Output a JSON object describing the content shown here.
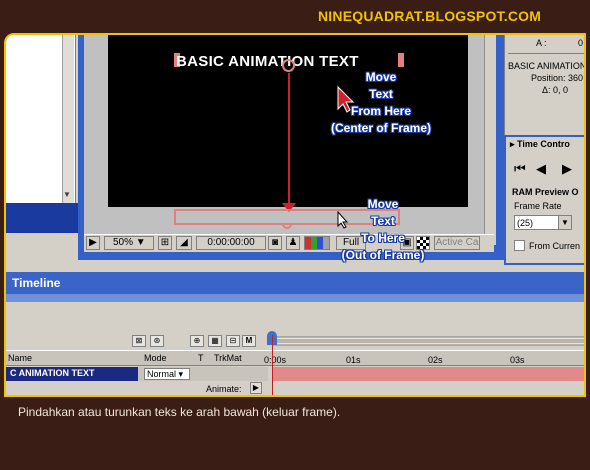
{
  "blog_title": "NINEQUADRAT.BLOGSPOT.COM",
  "caption": "Pindahkan atau turunkan teks ke arah bawah (keluar frame).",
  "composition": {
    "layer_text": "BASIC ANIMATION TEXT",
    "note_from": [
      "Move",
      "Text",
      "From Here",
      "(Center of Frame)"
    ],
    "note_to": [
      "Move",
      "Text",
      "To Here",
      "(Out of Frame)"
    ],
    "toolbar": {
      "zoom": "50%",
      "timecode": "0:00:00:00",
      "resolution": "Full",
      "active_camera": "Active Ca"
    }
  },
  "info_panel": {
    "a_label": "A :",
    "a_value": "0",
    "layer_name": "BASIC ANIMATION",
    "position": "Position: 360",
    "delta": "Δ: 0, 0"
  },
  "time_controls": {
    "title": "Time Contro",
    "ram_preview": "RAM Preview O",
    "frame_rate_label": "Frame Rate",
    "frame_rate_value": "(25)",
    "from_current": "From Curren"
  },
  "timeline": {
    "title": "Timeline",
    "columns": {
      "name": "Name",
      "mode": "Mode",
      "t": "T",
      "trkmat": "TrkMat"
    },
    "ruler": [
      "0:00s",
      "01s",
      "02s",
      "03s"
    ],
    "layer_name": "C ANIMATION TEXT",
    "mode_value": "Normal",
    "animate_label": "Animate:"
  },
  "colors": {
    "background": "#3a1d14",
    "title_yellow": "#f2c200",
    "timeline_blue": "#3a64c8",
    "arrow_red": "#d0202a",
    "track_pink": "#e08a8a"
  }
}
